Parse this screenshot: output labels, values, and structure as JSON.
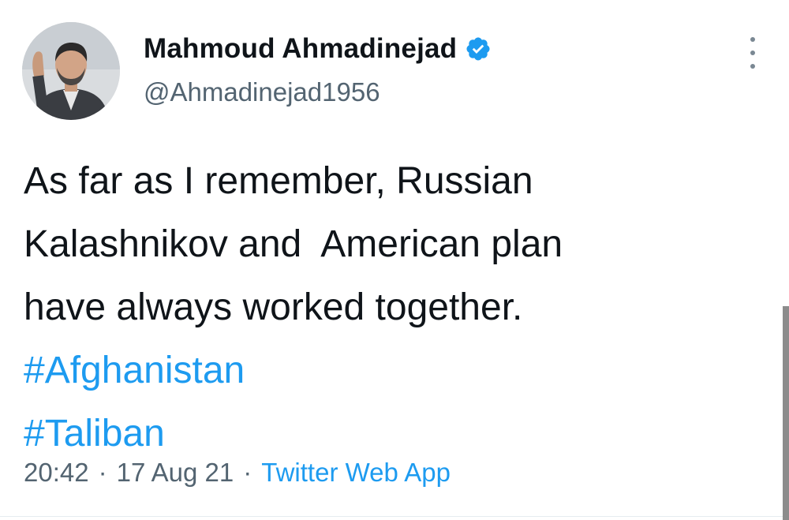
{
  "user": {
    "display_name": "Mahmoud Ahmadinejad",
    "handle": "@Ahmadinejad1956",
    "verified": true
  },
  "tweet": {
    "lines": [
      "As far as I remember, Russian",
      "Kalashnikov and  American plan",
      "have always worked together."
    ],
    "hashtags": [
      "#Afghanistan",
      "#Taliban"
    ],
    "time": "20:42",
    "date": "17 Aug 21",
    "separator": "·",
    "source": "Twitter Web App"
  },
  "icons": {
    "verified": "verified-badge-icon",
    "more": "more-options-icon",
    "avatar": "profile-photo"
  },
  "colors": {
    "text": "#0f1419",
    "secondary": "#536471",
    "link": "#1d9bf0",
    "verified": "#1d9bf0"
  }
}
